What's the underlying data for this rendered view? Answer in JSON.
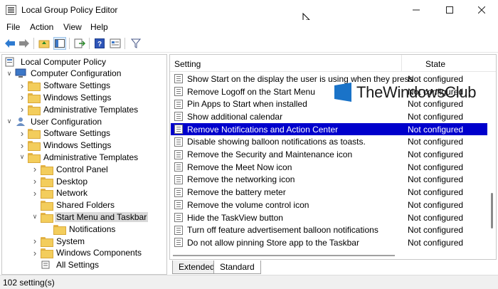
{
  "window": {
    "title": "Local Group Policy Editor"
  },
  "menu": [
    "File",
    "Action",
    "View",
    "Help"
  ],
  "tree": {
    "items": [
      {
        "label": "Local Computer Policy",
        "indent": 0,
        "chevron": "",
        "icon": "computer-policy-icon"
      },
      {
        "label": "Computer Configuration",
        "indent": 1,
        "chevron": "down",
        "icon": "computer-icon"
      },
      {
        "label": "Software Settings",
        "indent": 2,
        "chevron": "right",
        "icon": "folder-icon"
      },
      {
        "label": "Windows Settings",
        "indent": 2,
        "chevron": "right",
        "icon": "folder-icon"
      },
      {
        "label": "Administrative Templates",
        "indent": 2,
        "chevron": "right",
        "icon": "folder-icon"
      },
      {
        "label": "User Configuration",
        "indent": 1,
        "chevron": "down",
        "icon": "user-icon"
      },
      {
        "label": "Software Settings",
        "indent": 2,
        "chevron": "right",
        "icon": "folder-icon"
      },
      {
        "label": "Windows Settings",
        "indent": 2,
        "chevron": "right",
        "icon": "folder-icon"
      },
      {
        "label": "Administrative Templates",
        "indent": 2,
        "chevron": "down",
        "icon": "folder-icon"
      },
      {
        "label": "Control Panel",
        "indent": 3,
        "chevron": "right",
        "icon": "folder-icon"
      },
      {
        "label": "Desktop",
        "indent": 3,
        "chevron": "right",
        "icon": "folder-icon"
      },
      {
        "label": "Network",
        "indent": 3,
        "chevron": "right",
        "icon": "folder-icon"
      },
      {
        "label": "Shared Folders",
        "indent": 3,
        "chevron": "",
        "icon": "folder-icon"
      },
      {
        "label": "Start Menu and Taskbar",
        "indent": 3,
        "chevron": "down",
        "icon": "folder-icon",
        "selected": true
      },
      {
        "label": "Notifications",
        "indent": 4,
        "chevron": "",
        "icon": "folder-icon"
      },
      {
        "label": "System",
        "indent": 3,
        "chevron": "right",
        "icon": "folder-icon"
      },
      {
        "label": "Windows Components",
        "indent": 3,
        "chevron": "right",
        "icon": "folder-icon"
      },
      {
        "label": "All Settings",
        "indent": 3,
        "chevron": "",
        "icon": "all-settings-icon"
      }
    ]
  },
  "list": {
    "headers": {
      "setting": "Setting",
      "state": "State"
    },
    "rows": [
      {
        "setting": "Show Start on the display the user is using when they press t...",
        "state": "Not configured"
      },
      {
        "setting": "Remove Logoff on the Start Menu",
        "state": "Not configured"
      },
      {
        "setting": "Pin Apps to Start when installed",
        "state": "Not configured"
      },
      {
        "setting": "Show additional calendar",
        "state": "Not configured"
      },
      {
        "setting": "Remove Notifications and Action Center",
        "state": "Not configured",
        "selected": true
      },
      {
        "setting": "Disable showing balloon notifications as toasts.",
        "state": "Not configured"
      },
      {
        "setting": "Remove the Security and Maintenance icon",
        "state": "Not configured"
      },
      {
        "setting": "Remove the Meet Now icon",
        "state": "Not configured"
      },
      {
        "setting": "Remove the networking icon",
        "state": "Not configured"
      },
      {
        "setting": "Remove the battery meter",
        "state": "Not configured"
      },
      {
        "setting": "Remove the volume control icon",
        "state": "Not configured"
      },
      {
        "setting": "Hide the TaskView button",
        "state": "Not configured"
      },
      {
        "setting": "Turn off feature advertisement balloon notifications",
        "state": "Not configured"
      },
      {
        "setting": "Do not allow pinning Store app to the Taskbar",
        "state": "Not configured"
      }
    ]
  },
  "tabs": [
    {
      "label": "Extended",
      "active": false
    },
    {
      "label": "Standard",
      "active": true
    }
  ],
  "status": {
    "text": "102 setting(s)"
  },
  "watermark": {
    "text": "TheWindowsClub"
  },
  "colors": {
    "selection": "#0000cc",
    "folder": "#f3cd5c",
    "watermark_blue": "#1a73c8"
  }
}
